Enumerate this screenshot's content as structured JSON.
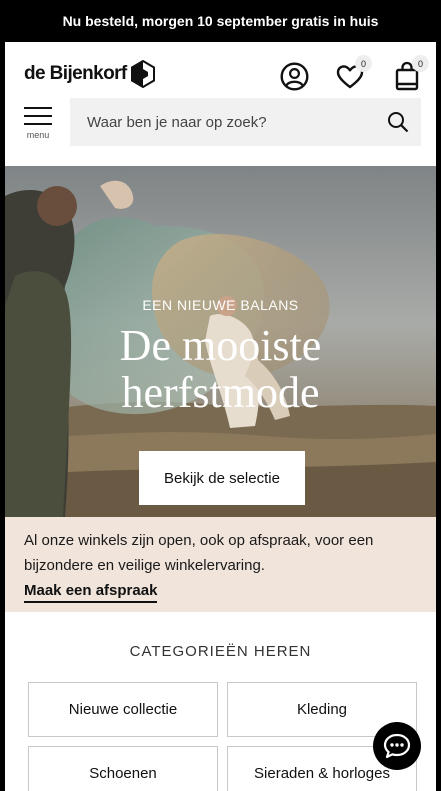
{
  "promo": {
    "text": "Nu besteld, morgen 10 september gratis in huis"
  },
  "header": {
    "logo_text": "de Bijenkorf",
    "account_icon": "account-icon",
    "wishlist_icon": "heart-icon",
    "wishlist_count": "0",
    "bag_icon": "shopping-bag-icon",
    "bag_count": "0",
    "menu_label": "menu",
    "search_placeholder": "Waar ben je naar op zoek?"
  },
  "hero": {
    "eyebrow": "EEN NIEUWE BALANS",
    "title_line1": "De mooiste",
    "title_line2": "herfstmode",
    "cta_label": "Bekijk de selectie"
  },
  "notice": {
    "text": "Al onze winkels zijn open, ook op afspraak, voor een bijzondere en veilige winkelervaring.",
    "link_label": "Maak een afspraak",
    "background": "#f0e4db"
  },
  "categories": {
    "title": "CATEGORIEËN HEREN",
    "items": [
      {
        "label": "Nieuwe collectie"
      },
      {
        "label": "Kleding"
      },
      {
        "label": "Schoenen"
      },
      {
        "label": "Sieraden & horloges"
      }
    ]
  },
  "chat": {
    "icon": "chat-icon"
  }
}
